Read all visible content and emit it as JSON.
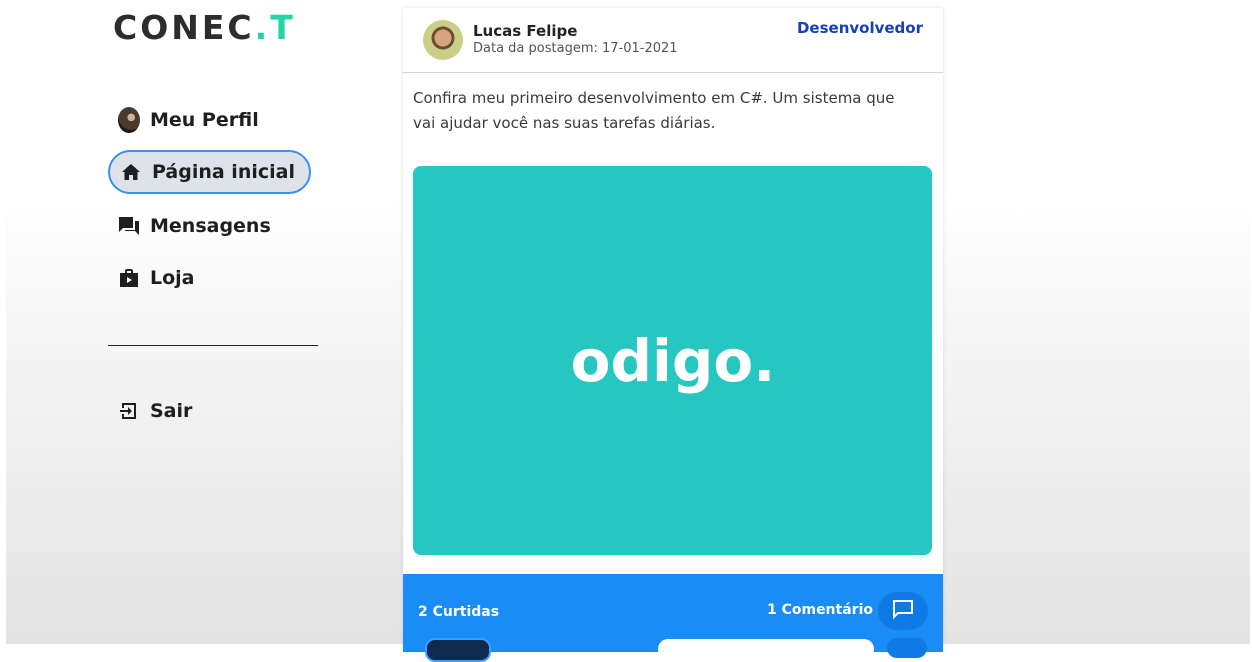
{
  "brand": {
    "logo_main": "CONEC",
    "logo_dot": ".",
    "logo_t": "T",
    "accent": "#1fd6a4"
  },
  "sidebar": {
    "items": [
      {
        "label": "Meu Perfil",
        "icon": "user-avatar"
      },
      {
        "label": "Página inicial",
        "icon": "home-icon",
        "active": true
      },
      {
        "label": "Mensagens",
        "icon": "chat-icon"
      },
      {
        "label": "Loja",
        "icon": "shopping-bag-icon"
      }
    ],
    "logout": {
      "label": "Sair",
      "icon": "logout-icon"
    }
  },
  "post": {
    "author": "Lucas Felipe",
    "date": "Data da postagem: 17-01-2021",
    "role": "Desenvolvedor",
    "text": "Confira meu primeiro desenvolvimento em C#. Um sistema que vai ajudar você nas suas tarefas diárias.",
    "image_logo": "odigo.",
    "image_bg": "#26c7c1",
    "likes": "2 Curtidas",
    "comments": "1 Comentário",
    "footer_color": "#1a8cf5"
  }
}
